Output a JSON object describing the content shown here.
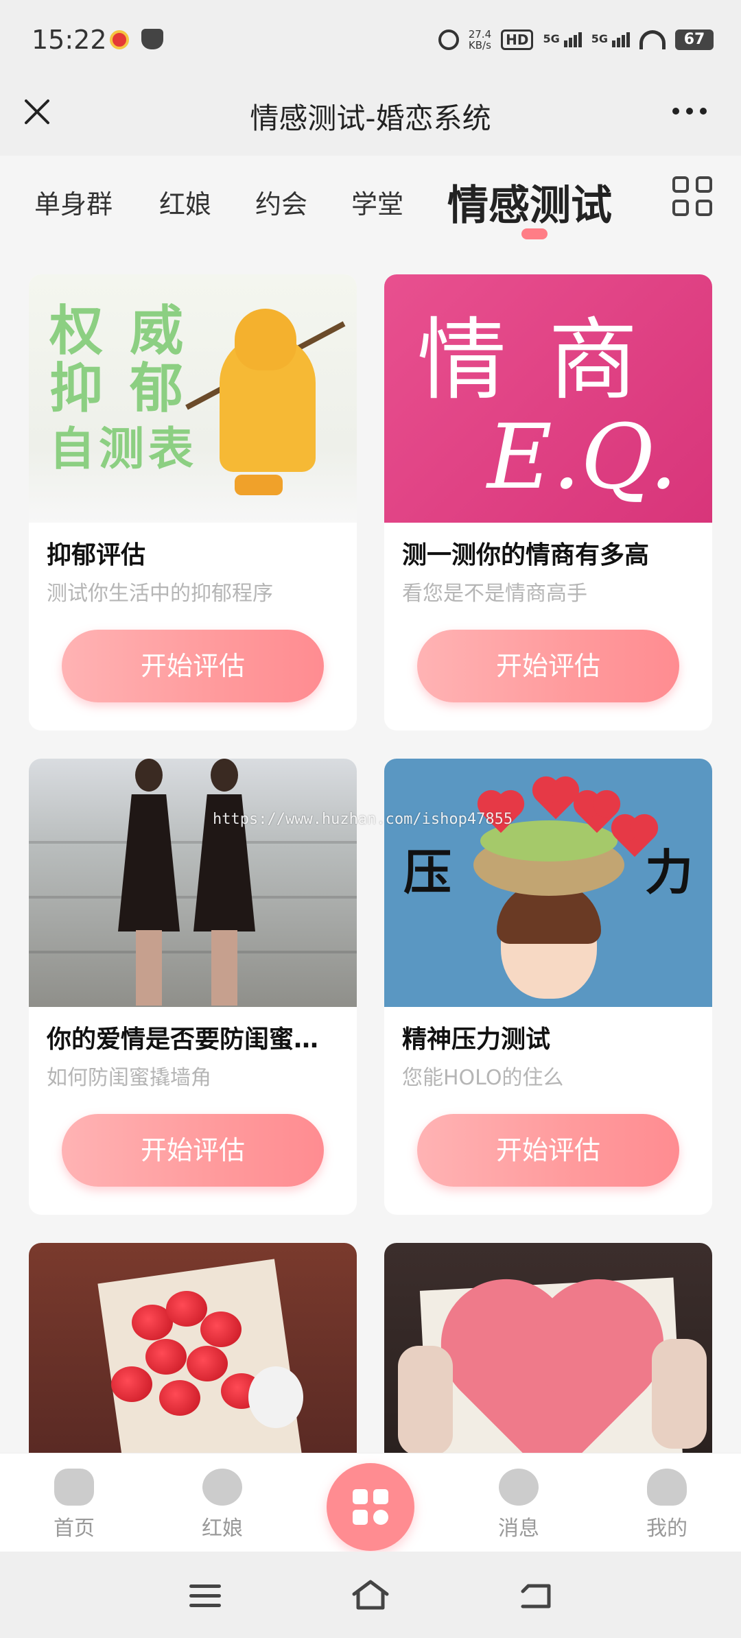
{
  "status_bar": {
    "time": "15:22",
    "net_speed_value": "27.4",
    "net_speed_unit": "KB/s",
    "hd_label": "HD",
    "signal1": "5G",
    "signal2": "5G",
    "battery": "67"
  },
  "header": {
    "title": "情感测试-婚恋系统"
  },
  "tabs": [
    {
      "label": "单身群"
    },
    {
      "label": "红娘"
    },
    {
      "label": "约会"
    },
    {
      "label": "学堂"
    },
    {
      "label": "情感测试",
      "active": true
    }
  ],
  "cards": [
    {
      "title": "抑郁评估",
      "desc": "测试你生活中的抑郁程序",
      "button": "开始评估",
      "image_text": [
        "权 威",
        "抑 郁",
        "自测表"
      ]
    },
    {
      "title": "测一测你的情商有多高",
      "desc": "看您是不是情商高手",
      "button": "开始评估",
      "image_text": [
        "情 商",
        "E.Q."
      ]
    },
    {
      "title": "你的爱情是否要防闺蜜…",
      "desc": "如何防闺蜜撬墙角",
      "button": "开始评估"
    },
    {
      "title": "精神压力测试",
      "desc": "您能HOLO的住么",
      "button": "开始评估",
      "image_text": [
        "压",
        "力"
      ]
    },
    {
      "title": "",
      "desc": "",
      "button": ""
    },
    {
      "title": "",
      "desc": "",
      "button": ""
    }
  ],
  "watermark": "https://www.huzhan.com/ishop47855",
  "bottom_nav": [
    {
      "label": "首页",
      "icon": "home-icon"
    },
    {
      "label": "红娘",
      "icon": "matchmaker-icon"
    },
    {
      "label": "",
      "icon": "apps-icon"
    },
    {
      "label": "消息",
      "icon": "message-icon"
    },
    {
      "label": "我的",
      "icon": "profile-icon"
    }
  ],
  "colors": {
    "accent": "#ff8c91",
    "tab_indicator": "#ff7d86",
    "nav_inactive": "#cccccc"
  }
}
